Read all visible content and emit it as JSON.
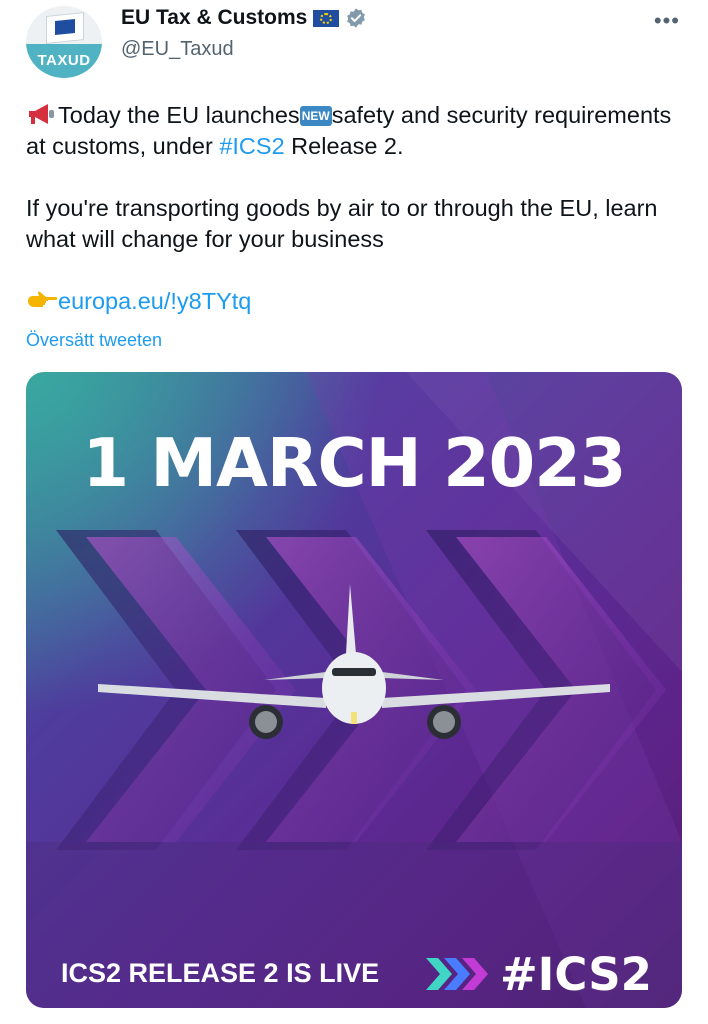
{
  "account": {
    "display_name": "EU Tax & Customs",
    "handle": "@EU_Taxud",
    "avatar_label": "TAXUD",
    "flag_icon": "eu-flag-icon",
    "verified_icon": "verified-badge-icon",
    "more_icon": "more-options-icon"
  },
  "tweet": {
    "line1_pre": "Today the EU launches",
    "new_badge": "NEW",
    "line1_post": "safety and security requirements at customs, under ",
    "hashtag": "#ICS2",
    "line1_end": " Release 2.",
    "paragraph2": "If you're transporting goods by air to or through the EU, learn what will change for your business",
    "link": "europa.eu/!y8TYtq",
    "translate_label": "Översätt tweeten"
  },
  "media": {
    "date": "1 MARCH 2023",
    "caption": "ICS2 RELEASE 2 IS LIVE",
    "tag": "#ICS2",
    "colors": {
      "teal": "#39a8a0",
      "purple": "#5a2c95",
      "magenta": "#a32fb8",
      "arrow_teal": "#3fd6c5",
      "arrow_blue": "#4a7cff",
      "arrow_pink": "#c23bd4"
    }
  }
}
